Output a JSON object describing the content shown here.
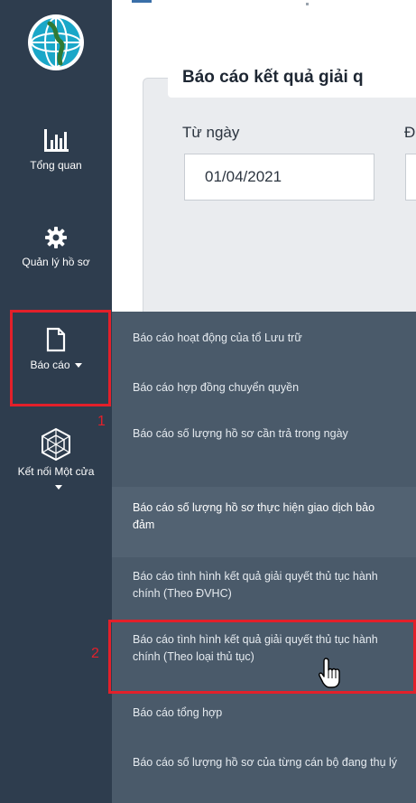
{
  "content": {
    "report_title": "Báo cáo kết quả giải q",
    "from_date_label": "Từ ngày",
    "to_date_label_partial": "Đ",
    "from_date_value": "01/04/2021"
  },
  "sidebar": {
    "items": [
      {
        "label": "Tổng quan",
        "icon": "bar-chart-icon"
      },
      {
        "label": "Quản lý hồ sơ",
        "icon": "gear-icon"
      },
      {
        "label": "Báo cáo",
        "icon": "document-icon"
      },
      {
        "label": "Kết nối Một cửa",
        "icon": "network-icon"
      }
    ]
  },
  "report_menu": {
    "items": [
      "Báo cáo hoạt động của tổ Lưu trữ",
      "Báo cáo hợp đồng chuyển quyền",
      "Báo cáo số lượng hồ sơ cần trả trong ngày",
      "Báo cáo số lượng hồ sơ thực hiện giao dịch bảo đảm",
      "Báo cáo tình hình kết quả giải quyết thủ tục hành chính (Theo ĐVHC)",
      "Báo cáo tình hình kết quả giải quyết thủ tục hành chính (Theo loại thủ tục)",
      "Báo cáo tổng hợp",
      "Báo cáo số lượng hồ sơ của từng cán bộ đang thụ lý"
    ]
  },
  "annotations": {
    "step1": "1",
    "step2": "2",
    "highlight_color": "#e3202a"
  },
  "colors": {
    "sidebar_bg": "#2e3d4e",
    "submenu_bg": "#4a5a6a"
  }
}
